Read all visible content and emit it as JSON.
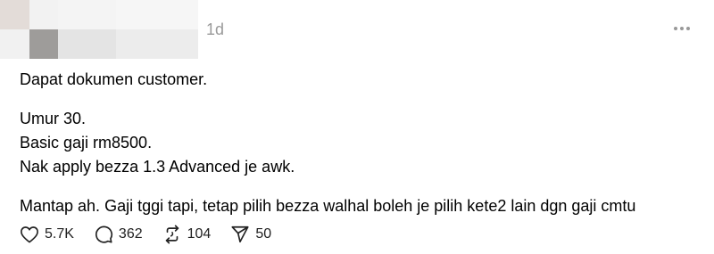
{
  "post": {
    "timestamp": "1d",
    "paragraphs": {
      "p1": "Dapat dokumen customer.",
      "p2_lines": [
        "Umur 30.",
        "Basic gaji rm8500.",
        "Nak apply bezza 1.3 Advanced je awk."
      ],
      "p3": "Mantap ah. Gaji tggi tapi, tetap pilih bezza walhal boleh je pilih kete2 lain dgn gaji cmtu"
    }
  },
  "actions": {
    "like": {
      "icon": "heart-icon",
      "count": "5.7K"
    },
    "comment": {
      "icon": "speech-bubble-icon",
      "count": "362"
    },
    "repost": {
      "icon": "repost-icon",
      "count": "104"
    },
    "share": {
      "icon": "send-icon",
      "count": "50"
    }
  },
  "colors": {
    "text": "#000000",
    "muted": "#9a9a9a",
    "icon": "#222222"
  }
}
